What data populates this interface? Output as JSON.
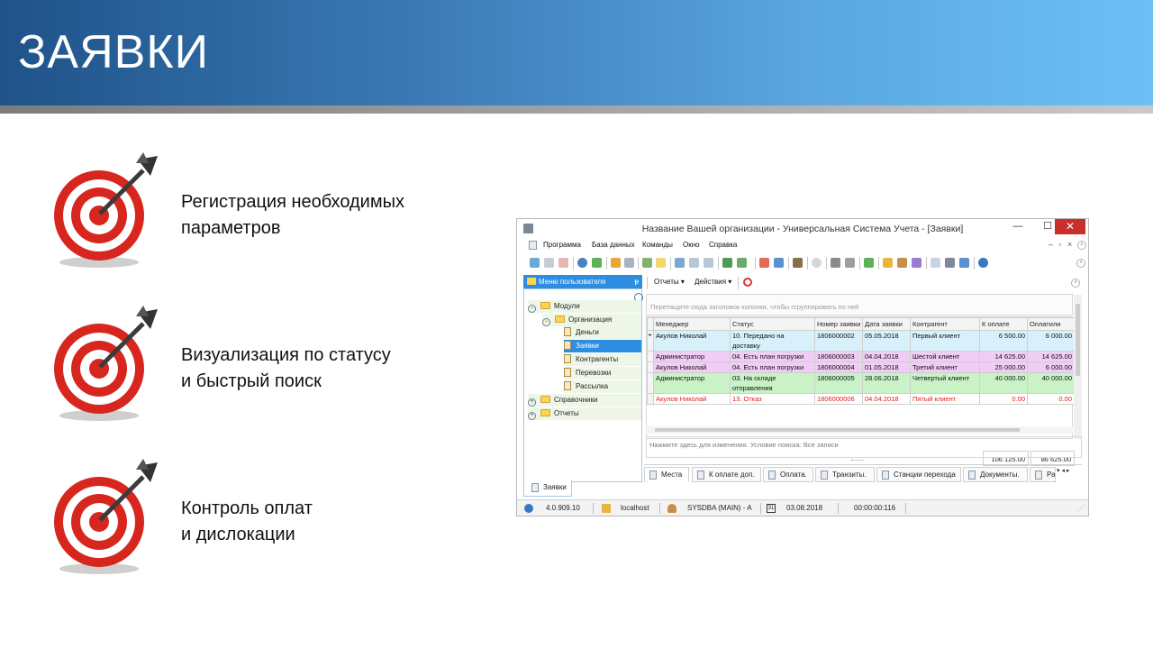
{
  "slide": {
    "title": "ЗАЯВКИ",
    "bullets": [
      {
        "line1": "Регистрация необходимых",
        "line2": "параметров"
      },
      {
        "line1": "Визуализация по статусу",
        "line2": "и быстрый поиск"
      },
      {
        "line1": "Контроль оплат",
        "line2": "и дислокации"
      }
    ],
    "colors": {
      "banner_start": "#1f5389",
      "banner_end": "#6dc0f6",
      "target_red": "#d7261e"
    }
  },
  "window": {
    "title": "Название Вашей организации - Универсальная Система Учета - [Заявки]",
    "controls": {
      "minimize": "—",
      "maximize": "☐",
      "close": "✕"
    }
  },
  "menu": {
    "items": [
      "Программа",
      "База данных",
      "Команды",
      "Окно",
      "Справка"
    ],
    "mdi_controls": {
      "minimize": "–",
      "restore": "▫",
      "close": "×"
    }
  },
  "left_panel": {
    "header": "Меню пользователя",
    "pin": "ᵽ",
    "tree": [
      {
        "label": "Модули",
        "level": 0,
        "type": "folder",
        "expander": "−"
      },
      {
        "label": "Организация",
        "level": 1,
        "type": "folder",
        "expander": "−"
      },
      {
        "label": "Деньги",
        "level": 2,
        "type": "doc"
      },
      {
        "label": "Заявки",
        "level": 2,
        "type": "doc",
        "selected": true
      },
      {
        "label": "Контрагенты",
        "level": 2,
        "type": "doc"
      },
      {
        "label": "Перевозки",
        "level": 2,
        "type": "doc"
      },
      {
        "label": "Рассылка",
        "level": 2,
        "type": "doc"
      },
      {
        "label": "Справочники",
        "level": 0,
        "type": "folder",
        "expander": "+"
      },
      {
        "label": "Отчеты",
        "level": 0,
        "type": "folder",
        "expander": "+"
      }
    ],
    "bottom_tab": "Заявки"
  },
  "sub_toolbar": {
    "reports": "Отчеты ▾",
    "actions": "Действия ▾"
  },
  "group_hint": "Перетащите сюда заголовок колонки, чтобы сгруппировать по ней",
  "grid": {
    "columns": [
      "Менеджер",
      "Статус",
      "Номер заявки",
      "Дата заявки",
      "Контрагент",
      "К оплате",
      "Оплатили"
    ],
    "rows": [
      {
        "manager": "Акулов Николай",
        "status": "10. Передано на доставку",
        "number": "1806000002",
        "date": "05.05.2018",
        "client": "Первый клиент",
        "to_pay": "6 500.00",
        "paid": "6 000.00",
        "bg": "#d8f0fb",
        "fg": "#111111",
        "current": true
      },
      {
        "manager": "Администратор",
        "status": "04. Есть план погрузки",
        "number": "1806000003",
        "date": "04.04.2018",
        "client": "Шестой клиент",
        "to_pay": "14 625.00",
        "paid": "14 625.00",
        "bg": "#f0cdf4",
        "fg": "#111111"
      },
      {
        "manager": "Акулов Николай",
        "status": "04. Есть план погрузки",
        "number": "1806000004",
        "date": "01.05.2018",
        "client": "Третий клиент",
        "to_pay": "25 000.00",
        "paid": "6 000.00",
        "bg": "#f0cdf4",
        "fg": "#111111"
      },
      {
        "manager": "Администратор",
        "status": "03. На складе отправления",
        "number": "1806000005",
        "date": "28.06.2018",
        "client": "Четвертый клиент",
        "to_pay": "40 000.00",
        "paid": "40 000.00",
        "bg": "#c9f2c6",
        "fg": "#111111"
      },
      {
        "manager": "Акулов Николай",
        "status": "13. Отказ",
        "number": "1806000006",
        "date": "04.04.2018",
        "client": "Пятый клиент",
        "to_pay": "0.00",
        "paid": "0.00",
        "bg": "#ffffff",
        "fg": "#e0201b"
      }
    ],
    "totals": {
      "to_pay": "106 125.00",
      "paid": "86 625.00"
    },
    "row_indicator": "▸"
  },
  "filter_text": "Нажмите здесь для изменения. Условие поиска: Все записи",
  "bottom_tabs": [
    "Места",
    "К оплате доп.",
    "Оплата.",
    "Транзиты.",
    "Станции перехода",
    "Документы.",
    "Раб"
  ],
  "tab_arrows": "▾ ◂ ▸",
  "status_bar": {
    "version": "4.0.909.10",
    "server": "localhost",
    "user": "SYSDBA (MAIN) - A",
    "date": "03.08.2018",
    "timer": "00:00:00:116",
    "date_icon_label": "31"
  }
}
